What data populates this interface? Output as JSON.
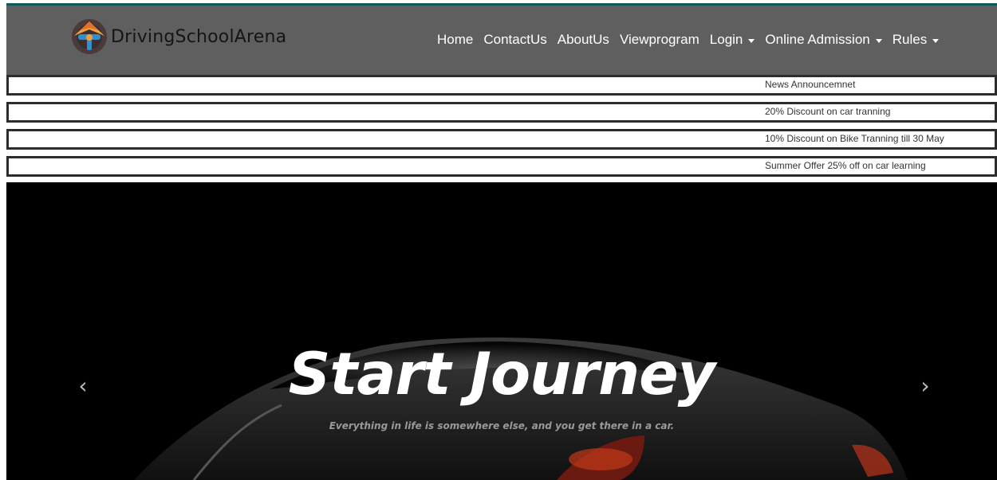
{
  "brand": {
    "name": "DrivingSchoolArena",
    "logo_icon": "steering-wheel-logo"
  },
  "nav": {
    "items": [
      {
        "label": "Home"
      },
      {
        "label": "ContactUs"
      },
      {
        "label": "AboutUs"
      },
      {
        "label": "Viewprogram"
      },
      {
        "label": "Login"
      },
      {
        "label": "Online Admission"
      },
      {
        "label": "Rules"
      }
    ]
  },
  "news": [
    "News Announcemnet",
    "20% Discount on car tranning",
    "10% Discount on Bike Tranning till 30 May",
    "Summer Offer 25% off on car learning"
  ],
  "hero": {
    "title": "Start Journey",
    "subtitle": "Everything in life is somewhere else, and you get there in a car.",
    "prev_icon": "‹",
    "next_icon": "›"
  },
  "colors": {
    "navbar": "#5f5f5f",
    "top_line": "#0d5a5a",
    "news_border": "#2c2c2c",
    "hero_bg": "#000000"
  }
}
